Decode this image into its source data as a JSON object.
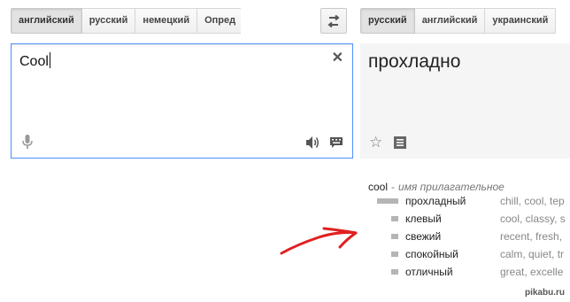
{
  "source_languages": [
    "английский",
    "русский",
    "немецкий",
    "Опред"
  ],
  "target_languages": [
    "русский",
    "английский",
    "украинский"
  ],
  "source": {
    "text": "Cool"
  },
  "result": {
    "text": "прохладно"
  },
  "dictionary": {
    "word": "cool",
    "separator": "-",
    "part_of_speech": "имя прилагательное",
    "entries": [
      {
        "term": "прохладный",
        "synonyms": "chill, cool, tep",
        "frequency": 1.0
      },
      {
        "term": "клевый",
        "synonyms": "cool, classy, s",
        "frequency": 0.33
      },
      {
        "term": "свежий",
        "synonyms": "recent, fresh,",
        "frequency": 0.33
      },
      {
        "term": "спокойный",
        "synonyms": "calm, quiet, tr",
        "frequency": 0.33
      },
      {
        "term": "отличный",
        "synonyms": "great, excelle",
        "frequency": 0.33
      }
    ]
  },
  "watermark": "pikabu.ru",
  "colors": {
    "focus_border": "#4d90fe",
    "annotation_arrow": "#e02020"
  },
  "icons": [
    "swap-icon",
    "clear-icon",
    "microphone-icon",
    "speaker-icon",
    "keyboard-icon",
    "star-icon",
    "list-icon"
  ]
}
